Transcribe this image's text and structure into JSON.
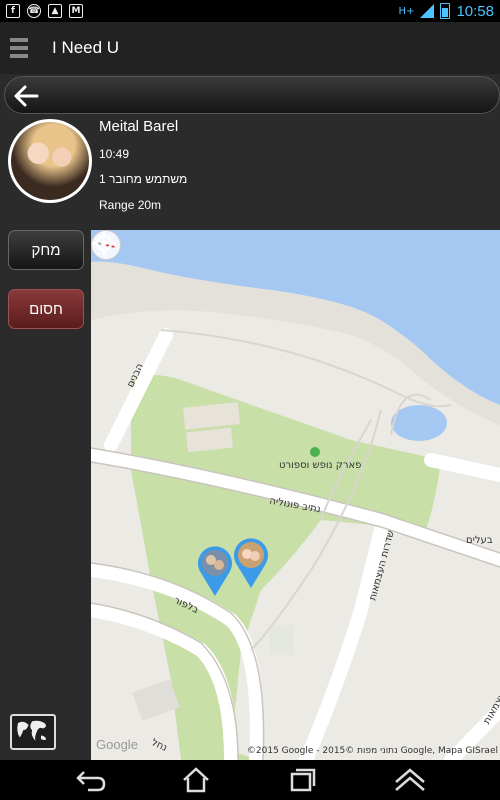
{
  "status_bar": {
    "icons_left": [
      "facebook-icon",
      "whatsapp-icon",
      "gallery-icon",
      "gmail-icon"
    ],
    "signal_label": "H+",
    "time": "10:58"
  },
  "action_bar": {
    "title": "I Need U"
  },
  "profile": {
    "name": "Meital Barel",
    "time": "10:49",
    "connected_users": "1 משתמש מחובר",
    "range": "Range 20m"
  },
  "side_panel": {
    "delete_label": "מחק",
    "block_label": "חסום"
  },
  "map": {
    "park_label": "פארק נופש וספורט",
    "street_1": "נתיב פונוליה",
    "street_2": "שדרות העצמאות",
    "street_3": "בלפור",
    "street_4": "העצמאות",
    "street_5": "בעלים",
    "street_6": "הבנים",
    "street_7": "נחל",
    "google_logo": "Google",
    "attribution": "©2015 Google - נתוני מפות ©2015 Google, Mapa GISrael",
    "colors": {
      "water": "#a5c8f2",
      "park": "#c8dfa8",
      "land": "#eceae5",
      "road": "#ffffff",
      "pin": "#3c9be8"
    }
  }
}
